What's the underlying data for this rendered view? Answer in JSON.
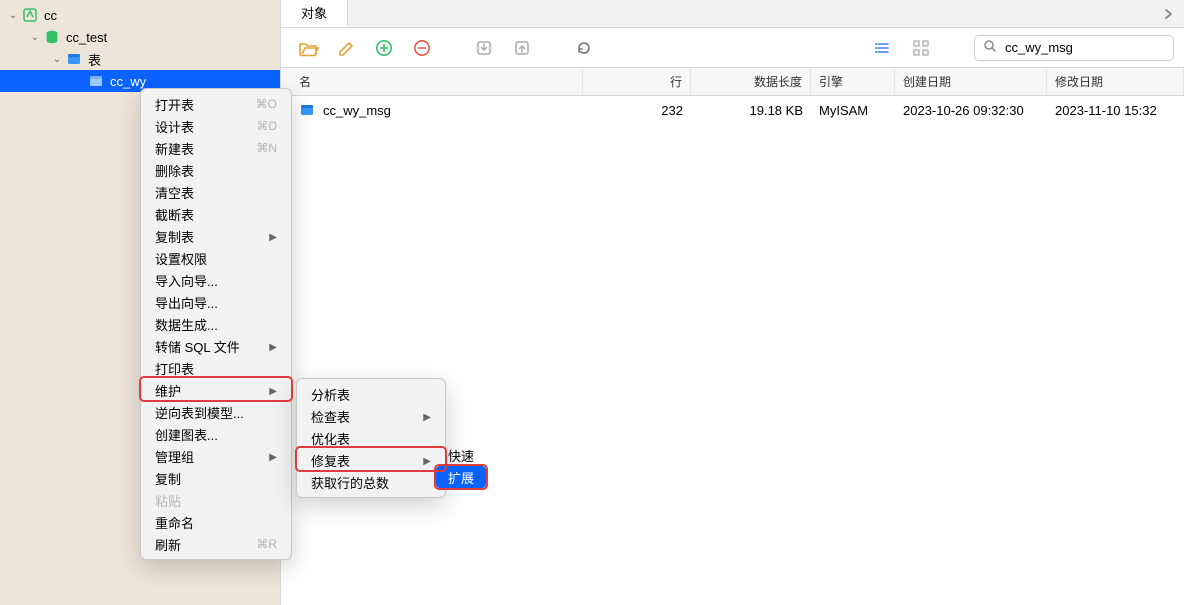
{
  "tree": {
    "root": {
      "label": "cc"
    },
    "db": {
      "label": "cc_test"
    },
    "tables_node": {
      "label": "表"
    },
    "sel_table": {
      "label": "cc_wy"
    }
  },
  "tab": {
    "label": "对象"
  },
  "toolbar": {
    "open_icon": "folder-open",
    "edit_icon": "pencil",
    "add_icon": "plus-circle",
    "del_icon": "minus-circle",
    "import_icon": "import",
    "export_icon": "export",
    "refresh_icon": "refresh",
    "list_icon": "list-view",
    "grid_icon": "grid-view"
  },
  "search": {
    "value": "cc_wy_msg"
  },
  "columns": {
    "name": "名",
    "rows": "行",
    "size": "数据长度",
    "engine": "引擎",
    "cdate": "创建日期",
    "mdate": "修改日期"
  },
  "table_rows": [
    {
      "name": "cc_wy_msg",
      "rows": "232",
      "size": "19.18 KB",
      "engine": "MyISAM",
      "cdate": "2023-10-26 09:32:30",
      "mdate": "2023-11-10 15:32"
    }
  ],
  "menu1": [
    {
      "label": "打开表",
      "shortcut": "⌘O"
    },
    {
      "label": "设计表",
      "shortcut": "⌘D"
    },
    {
      "label": "新建表",
      "shortcut": "⌘N"
    },
    {
      "label": "删除表"
    },
    {
      "label": "清空表"
    },
    {
      "label": "截断表"
    },
    {
      "label": "复制表",
      "arrow": true
    },
    {
      "label": "设置权限"
    },
    {
      "label": "导入向导..."
    },
    {
      "label": "导出向导..."
    },
    {
      "label": "数据生成..."
    },
    {
      "label": "转储 SQL 文件",
      "arrow": true
    },
    {
      "label": "打印表"
    },
    {
      "label": "维护",
      "arrow": true,
      "highlight": true
    },
    {
      "label": "逆向表到模型..."
    },
    {
      "label": "创建图表..."
    },
    {
      "label": "管理组",
      "arrow": true
    },
    {
      "label": "复制"
    },
    {
      "label": "粘贴",
      "dim": true
    },
    {
      "label": "重命名"
    },
    {
      "label": "刷新",
      "shortcut": "⌘R"
    }
  ],
  "menu2": [
    {
      "label": "分析表"
    },
    {
      "label": "检查表",
      "arrow": true
    },
    {
      "label": "优化表"
    },
    {
      "label": "修复表",
      "arrow": true,
      "highlight": true
    },
    {
      "label": "获取行的总数"
    }
  ],
  "menu3": {
    "opt1": "快速",
    "opt2": "扩展"
  }
}
